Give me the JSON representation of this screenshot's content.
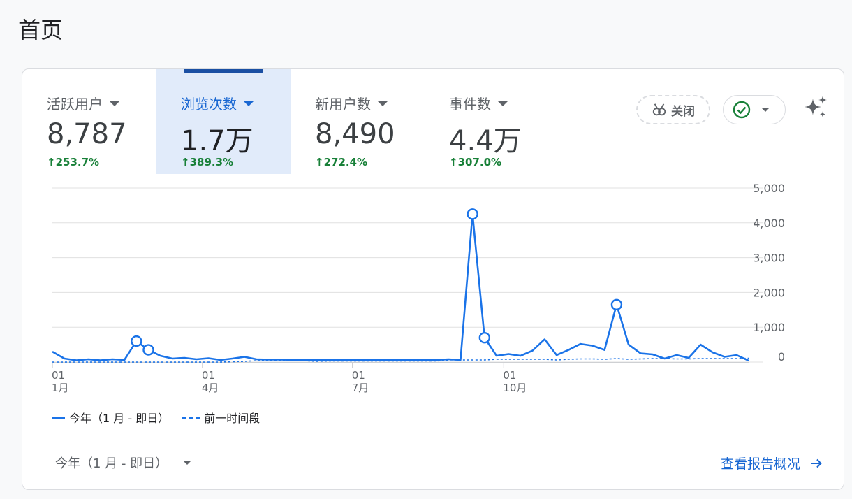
{
  "page": {
    "title": "首页"
  },
  "metrics": [
    {
      "label": "活跃用户",
      "value": "8,787",
      "change": "253.7%",
      "selected": false
    },
    {
      "label": "浏览次数",
      "value": "1.7万",
      "change": "389.3%",
      "selected": true
    },
    {
      "label": "新用户数",
      "value": "8,490",
      "change": "272.4%",
      "selected": false
    },
    {
      "label": "事件数",
      "value": "4.4万",
      "change": "307.0%",
      "selected": false
    }
  ],
  "toolbar": {
    "close_label": "关闭",
    "close_icon": "insights-off-icon",
    "check_icon": "check-circle-icon",
    "sparkle_icon": "sparkle-icon"
  },
  "chart_data": {
    "type": "line",
    "x_tick_labels": [
      {
        "day": "01",
        "month": "1月"
      },
      {
        "day": "01",
        "month": "4月"
      },
      {
        "day": "01",
        "month": "7月"
      },
      {
        "day": "01",
        "month": "10月"
      }
    ],
    "y_tick_labels": [
      "5,000",
      "4,000",
      "3,000",
      "2,000",
      "1,000",
      "0"
    ],
    "ylim": [
      0,
      5000
    ],
    "grid": true,
    "series": [
      {
        "name": "今年（1 月 - 即日）",
        "style": "solid",
        "color": "#1a73e8",
        "values": [
          300,
          100,
          50,
          80,
          50,
          80,
          60,
          600,
          350,
          180,
          100,
          120,
          80,
          110,
          60,
          100,
          150,
          80,
          70,
          70,
          60,
          60,
          60,
          60,
          60,
          60,
          60,
          60,
          60,
          60,
          60,
          60,
          60,
          80,
          60,
          4250,
          700,
          180,
          230,
          180,
          330,
          650,
          200,
          350,
          520,
          470,
          350,
          1650,
          500,
          250,
          220,
          100,
          200,
          120,
          500,
          280,
          150,
          200,
          40
        ],
        "markers": [
          7,
          8,
          35,
          36,
          47
        ]
      },
      {
        "name": "前一时间段",
        "style": "dashed",
        "color": "#1a73e8",
        "values": [
          0,
          0,
          0,
          0,
          0,
          0,
          0,
          0,
          0,
          0,
          0,
          0,
          0,
          0,
          0,
          10,
          20,
          40,
          40,
          40,
          40,
          40,
          20,
          30,
          30,
          30,
          30,
          30,
          30,
          30,
          30,
          30,
          30,
          60,
          60,
          60,
          60,
          80,
          80,
          80,
          80,
          80,
          60,
          80,
          90,
          90,
          80,
          100,
          80,
          90,
          100,
          100,
          90,
          90,
          100,
          100,
          100,
          100,
          110
        ]
      }
    ]
  },
  "legend": {
    "current": "今年（1 月 - 即日）",
    "previous": "前一时间段"
  },
  "footer": {
    "date_range": "今年（1 月 - 即日）",
    "view_report": "查看报告概况"
  }
}
